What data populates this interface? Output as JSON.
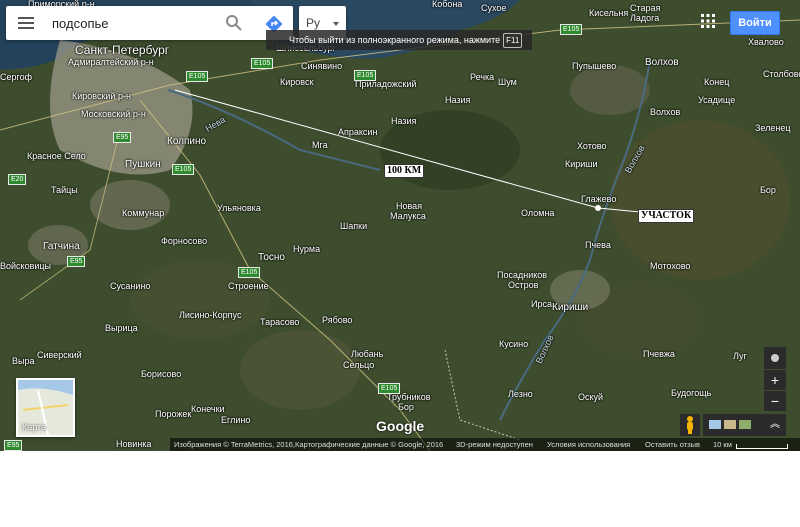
{
  "search": {
    "value": "подсопье",
    "menu_icon": "menu-icon",
    "search_icon": "search-icon",
    "directions_icon": "directions-icon"
  },
  "language": {
    "label": "Ру"
  },
  "fullscreen_notice": {
    "text": "Чтобы выйти из полноэкранного режима, нажмите",
    "key": "F11"
  },
  "header": {
    "apps_icon": "apps-grid-icon",
    "signin_label": "Войти"
  },
  "annotations": {
    "distance": "100 КМ",
    "plot": "УЧАСТОК"
  },
  "places": [
    {
      "name": "Приморский р-н",
      "size": "sm",
      "style": "left:28px;top:0px;"
    },
    {
      "name": "Кобона",
      "size": "sm",
      "style": "left:432px;top:0px;"
    },
    {
      "name": "Сухое",
      "size": "sm",
      "style": "left:481px;top:4px;"
    },
    {
      "name": "Кисельня",
      "size": "sm",
      "style": "left:589px;top:9px;"
    },
    {
      "name": "Старая",
      "size": "sm",
      "style": "left:630px;top:4px;"
    },
    {
      "name": "Ладога",
      "size": "sm",
      "style": "left:630px;top:14px;"
    },
    {
      "name": "Хвалово",
      "size": "sm",
      "style": "left:748px;top:38px;"
    },
    {
      "name": "Санкт-Петербург",
      "size": "big",
      "style": "left:75px;top:44px;"
    },
    {
      "name": "Адмиралтейский р-н",
      "size": "sm",
      "style": "left:68px;top:58px;"
    },
    {
      "name": "Шлиссельбург",
      "size": "sm",
      "style": "left:276px;top:44px;"
    },
    {
      "name": "Синявино",
      "size": "sm",
      "style": "left:301px;top:62px;"
    },
    {
      "name": "Пупышево",
      "size": "sm",
      "style": "left:572px;top:62px;"
    },
    {
      "name": "Волхов",
      "size": "mid",
      "style": "left:645px;top:58px;"
    },
    {
      "name": "Столбово",
      "size": "sm",
      "style": "left:763px;top:70px;"
    },
    {
      "name": "Сергоф",
      "size": "sm",
      "style": "left:0px;top:73px;"
    },
    {
      "name": "Кировск",
      "size": "sm",
      "style": "left:280px;top:78px;"
    },
    {
      "name": "Приладожский",
      "size": "sm",
      "style": "left:355px;top:80px;"
    },
    {
      "name": "Речка",
      "size": "sm",
      "style": "left:470px;top:73px;"
    },
    {
      "name": "Шум",
      "size": "sm",
      "style": "left:498px;top:78px;"
    },
    {
      "name": "Конец",
      "size": "sm",
      "style": "left:704px;top:78px;"
    },
    {
      "name": "Кировский р-н",
      "size": "sm",
      "style": "left:72px;top:92px;"
    },
    {
      "name": "Назия",
      "size": "sm",
      "style": "left:445px;top:96px;"
    },
    {
      "name": "Усадище",
      "size": "sm",
      "style": "left:698px;top:96px;"
    },
    {
      "name": "Московский р-н",
      "size": "sm",
      "style": "left:81px;top:110px;"
    },
    {
      "name": "Назия",
      "size": "sm",
      "style": "left:391px;top:117px;"
    },
    {
      "name": "Волхов",
      "size": "sm",
      "style": "left:650px;top:108px;"
    },
    {
      "name": "Зеленец",
      "size": "sm",
      "style": "left:755px;top:124px;"
    },
    {
      "name": "Апраксин",
      "size": "sm",
      "style": "left:338px;top:128px;"
    },
    {
      "name": "Колпино",
      "size": "mid",
      "style": "left:167px;top:137px;"
    },
    {
      "name": "Мга",
      "size": "sm",
      "style": "left:312px;top:141px;"
    },
    {
      "name": "Хотово",
      "size": "sm",
      "style": "left:577px;top:142px;"
    },
    {
      "name": "Красное Село",
      "size": "sm",
      "style": "left:27px;top:152px;"
    },
    {
      "name": "Пушкин",
      "size": "mid",
      "style": "left:125px;top:160px;"
    },
    {
      "name": "Кириши",
      "size": "sm",
      "style": "left:565px;top:160px;"
    },
    {
      "name": "Тайцы",
      "size": "sm",
      "style": "left:51px;top:186px;"
    },
    {
      "name": "Глажево",
      "size": "sm",
      "style": "left:581px;top:195px;"
    },
    {
      "name": "Бор",
      "size": "sm",
      "style": "left:760px;top:186px;"
    },
    {
      "name": "Коммунар",
      "size": "sm",
      "style": "left:122px;top:209px;"
    },
    {
      "name": "Ульяновка",
      "size": "sm",
      "style": "left:217px;top:204px;"
    },
    {
      "name": "Новая",
      "size": "sm",
      "style": "left:396px;top:202px;"
    },
    {
      "name": "Малукса",
      "size": "sm",
      "style": "left:390px;top:212px;"
    },
    {
      "name": "Оломна",
      "size": "sm",
      "style": "left:521px;top:209px;"
    },
    {
      "name": "Шапки",
      "size": "sm",
      "style": "left:340px;top:222px;"
    },
    {
      "name": "Гатчина",
      "size": "mid",
      "style": "left:43px;top:242px;"
    },
    {
      "name": "Форносово",
      "size": "sm",
      "style": "left:161px;top:237px;"
    },
    {
      "name": "Нурма",
      "size": "sm",
      "style": "left:293px;top:245px;"
    },
    {
      "name": "Пчева",
      "size": "sm",
      "style": "left:585px;top:241px;"
    },
    {
      "name": "Тосно",
      "size": "mid",
      "style": "left:258px;top:253px;"
    },
    {
      "name": "Войсковицы",
      "size": "sm",
      "style": "left:0px;top:262px;"
    },
    {
      "name": "Мотохово",
      "size": "sm",
      "style": "left:650px;top:262px;"
    },
    {
      "name": "Посадников",
      "size": "sm",
      "style": "left:497px;top:271px;"
    },
    {
      "name": "Остров",
      "size": "sm",
      "style": "left:508px;top:281px;"
    },
    {
      "name": "Сусанино",
      "size": "sm",
      "style": "left:110px;top:282px;"
    },
    {
      "name": "Строение",
      "size": "sm",
      "style": "left:228px;top:282px;"
    },
    {
      "name": "Ирса",
      "size": "sm",
      "style": "left:531px;top:300px;"
    },
    {
      "name": "Кириши",
      "size": "mid",
      "style": "left:552px;top:303px;"
    },
    {
      "name": "Лисино-Корпус",
      "size": "sm",
      "style": "left:179px;top:311px;"
    },
    {
      "name": "Тарасово",
      "size": "sm",
      "style": "left:260px;top:318px;"
    },
    {
      "name": "Рябово",
      "size": "sm",
      "style": "left:322px;top:316px;"
    },
    {
      "name": "Вырица",
      "size": "sm",
      "style": "left:105px;top:324px;"
    },
    {
      "name": "Кусино",
      "size": "sm",
      "style": "left:499px;top:340px;"
    },
    {
      "name": "Сиверский",
      "size": "sm",
      "style": "left:37px;top:351px;"
    },
    {
      "name": "Любань",
      "size": "sm",
      "style": "left:351px;top:350px;"
    },
    {
      "name": "Пчевжа",
      "size": "sm",
      "style": "left:643px;top:350px;"
    },
    {
      "name": "Выра",
      "size": "sm",
      "style": "left:12px;top:357px;"
    },
    {
      "name": "Сельцо",
      "size": "sm",
      "style": "left:343px;top:361px;"
    },
    {
      "name": "Луг",
      "size": "sm",
      "style": "left:733px;top:352px;"
    },
    {
      "name": "Борисово",
      "size": "sm",
      "style": "left:141px;top:370px;"
    },
    {
      "name": "Будогощь",
      "size": "sm",
      "style": "left:671px;top:389px;"
    },
    {
      "name": "Порожек",
      "size": "sm",
      "style": "left:155px;top:410px;"
    },
    {
      "name": "Конечки",
      "size": "sm",
      "style": "left:191px;top:405px;"
    },
    {
      "name": "Трубников",
      "size": "sm",
      "style": "left:387px;top:393px;"
    },
    {
      "name": "Бор",
      "size": "sm",
      "style": "left:398px;top:403px;"
    },
    {
      "name": "Лезно",
      "size": "sm",
      "style": "left:508px;top:390px;"
    },
    {
      "name": "Оскуй",
      "size": "sm",
      "style": "left:578px;top:393px;"
    },
    {
      "name": "Еглино",
      "size": "sm",
      "style": "left:221px;top:416px;"
    },
    {
      "name": "Новинка",
      "size": "sm",
      "style": "left:116px;top:440px;"
    }
  ],
  "highways": [
    {
      "label": "E105",
      "style": "left:560px;top:24px;"
    },
    {
      "label": "E105",
      "style": "left:186px;top:71px;"
    },
    {
      "label": "E105",
      "style": "left:251px;top:58px;"
    },
    {
      "label": "E105",
      "style": "left:354px;top:70px;"
    },
    {
      "label": "E95",
      "style": "left:113px;top:132px;"
    },
    {
      "label": "E105",
      "style": "left:172px;top:164px;"
    },
    {
      "label": "E20",
      "style": "left:8px;top:174px;"
    },
    {
      "label": "E95",
      "style": "left:67px;top:256px;"
    },
    {
      "label": "E105",
      "style": "left:238px;top:267px;"
    },
    {
      "label": "E105",
      "style": "left:378px;top:383px;"
    },
    {
      "label": "E95",
      "style": "left:4px;top:440px;"
    }
  ],
  "water_labels": [
    {
      "name": "Нева",
      "style": "left:205px;top:120px;transform:rotate(-30deg);"
    },
    {
      "name": "Волхов",
      "style": "left:620px;top:155px;transform:rotate(-60deg);"
    },
    {
      "name": "Волхов",
      "style": "left:530px;top:345px;transform:rotate(-65deg);"
    }
  ],
  "minimap": {
    "label": "Карта"
  },
  "controls": {
    "compass_icon": "compass-icon",
    "zoom_in": "+",
    "zoom_out": "−"
  },
  "footer": {
    "google": "Google",
    "imagery": "Изображения © TerraMetrics, 2016,Картографические данные © Google, 2016",
    "three_d": "3D-режим недоступен",
    "terms": "Условия использования",
    "feedback": "Оставить отзыв",
    "scale": "10 км"
  }
}
